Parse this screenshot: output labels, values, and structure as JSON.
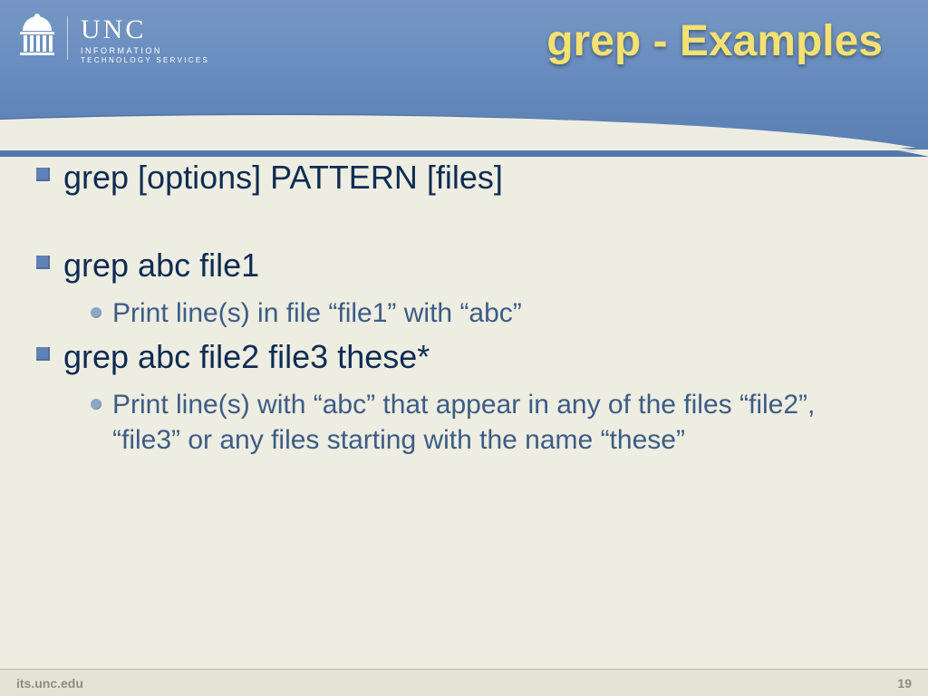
{
  "header": {
    "org_abbrev": "UNC",
    "org_line1": "INFORMATION",
    "org_line2": "TECHNOLOGY SERVICES",
    "title": "grep - Examples"
  },
  "content": {
    "bullets": [
      {
        "level": 1,
        "text": "grep [options] PATTERN [files]"
      },
      {
        "level": 1,
        "text": "grep abc file1"
      },
      {
        "level": 2,
        "text": "Print line(s) in file “file1” with “abc”"
      },
      {
        "level": 1,
        "text": "grep abc file2 file3 these*"
      },
      {
        "level": 2,
        "text": "Print line(s) with “abc” that appear in any of the files “file2”, “file3” or any files starting with the name “these”"
      }
    ]
  },
  "footer": {
    "url": "its.unc.edu",
    "page": "19"
  }
}
